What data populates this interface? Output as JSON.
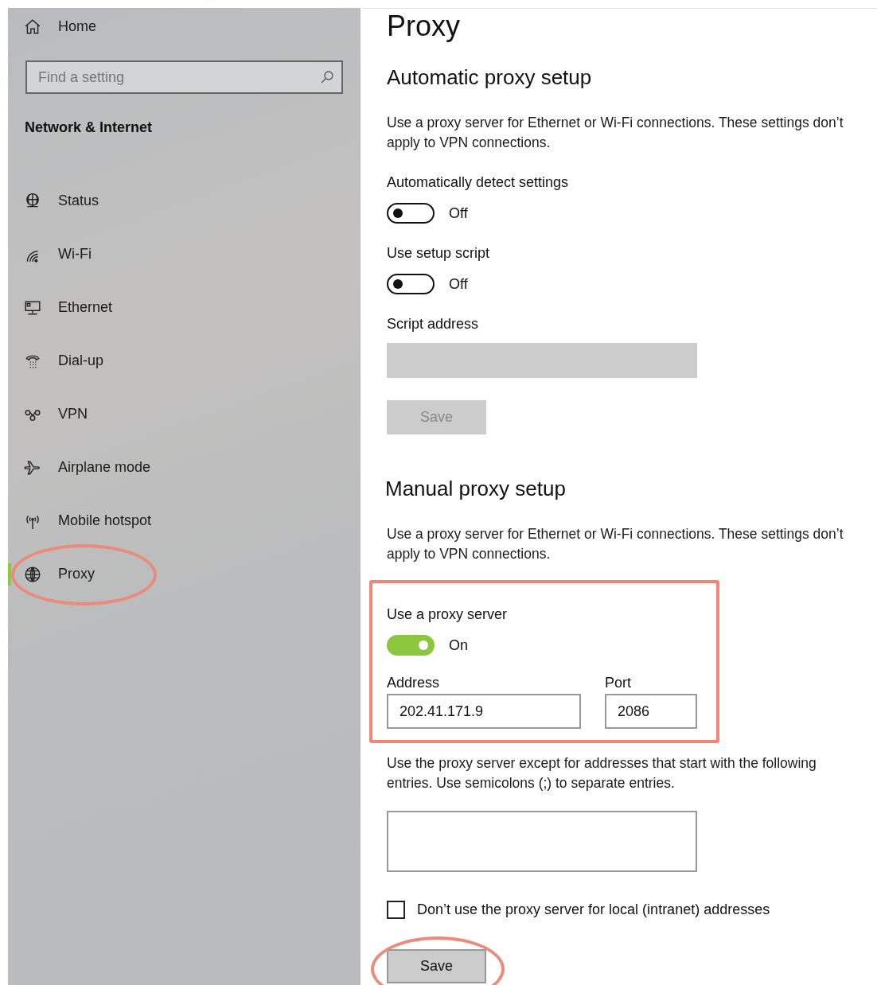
{
  "sidebar": {
    "home": {
      "label": "Home"
    },
    "search": {
      "placeholder": "Find a setting"
    },
    "heading": "Network & Internet",
    "items": [
      {
        "label": "Status",
        "selected": false,
        "circled": false
      },
      {
        "label": "Wi-Fi",
        "selected": false,
        "circled": false
      },
      {
        "label": "Ethernet",
        "selected": false,
        "circled": false
      },
      {
        "label": "Dial-up",
        "selected": false,
        "circled": false
      },
      {
        "label": "VPN",
        "selected": false,
        "circled": false
      },
      {
        "label": "Airplane mode",
        "selected": false,
        "circled": false
      },
      {
        "label": "Mobile hotspot",
        "selected": false,
        "circled": false
      },
      {
        "label": "Proxy",
        "selected": true,
        "circled": true
      }
    ]
  },
  "page": {
    "title": "Proxy",
    "automatic": {
      "heading": "Automatic proxy setup",
      "description": "Use a proxy server for Ethernet or Wi-Fi connections. These settings don’t apply to VPN connections.",
      "toggles": [
        {
          "label": "Automatically detect settings",
          "on": false,
          "state_text": "Off"
        },
        {
          "label": "Use setup script",
          "on": false,
          "state_text": "Off"
        }
      ],
      "script_address": {
        "label": "Script address",
        "disabled": true
      },
      "save": {
        "label": "Save",
        "disabled": true,
        "circled": false
      }
    },
    "manual": {
      "heading": "Manual proxy setup",
      "description": "Use a proxy server for Ethernet or Wi-Fi connections. These settings don’t apply to VPN connections.",
      "proxy_group": {
        "framed": true,
        "toggle": {
          "label": "Use a proxy server",
          "on": true,
          "state_text": "On"
        },
        "address": {
          "label": "Address",
          "value": "202.41.171.9"
        },
        "port": {
          "label": "Port",
          "value": "2086"
        }
      },
      "exceptions": {
        "description": "Use the proxy server except for addresses that start with the following entries. Use semicolons (;) to separate entries."
      },
      "bypass_local": {
        "label": "Don’t use the proxy server for local (intranet) addresses",
        "checked": false
      },
      "save": {
        "label": "Save",
        "disabled": false,
        "circled": true
      }
    }
  }
}
